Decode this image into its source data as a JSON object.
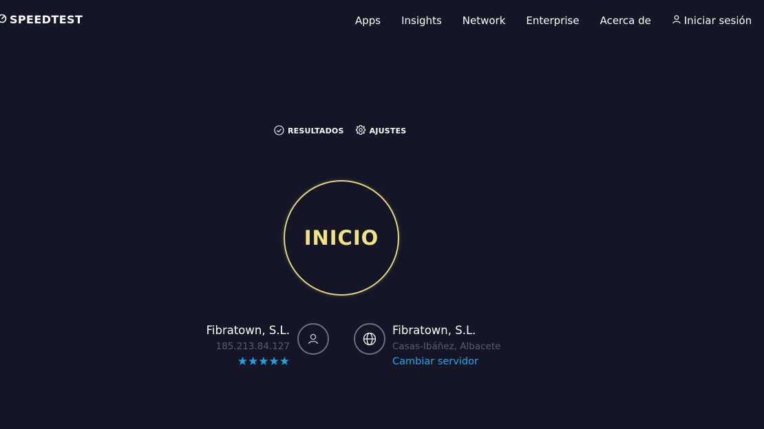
{
  "header": {
    "logo_text": "SPEEDTEST",
    "nav_items": [
      "Apps",
      "Insights",
      "Network",
      "Enterprise",
      "Acerca de"
    ],
    "login_label": "Iniciar sesión"
  },
  "tabs": {
    "results_label": "RESULTADOS",
    "settings_label": "AJUSTES"
  },
  "start": {
    "label": "INICIO"
  },
  "isp": {
    "name": "Fibratown, S.L.",
    "ip": "185.213.84.127",
    "rating": "★★★★★",
    "rating_value": 5
  },
  "server": {
    "name": "Fibratown, S.L.",
    "location": "Casas-Ibáñez, Albacete",
    "change_label": "Cambiar servidor"
  },
  "colors": {
    "background": "#141526",
    "accent_yellow": "#f1e383",
    "accent_blue": "#1fa7e6",
    "muted_text": "#585b6e"
  },
  "icons": {
    "logo": "speedometer-icon",
    "login": "user-icon",
    "results": "check-circle-icon",
    "settings": "gear-icon",
    "isp": "user-icon",
    "server": "globe-icon"
  }
}
